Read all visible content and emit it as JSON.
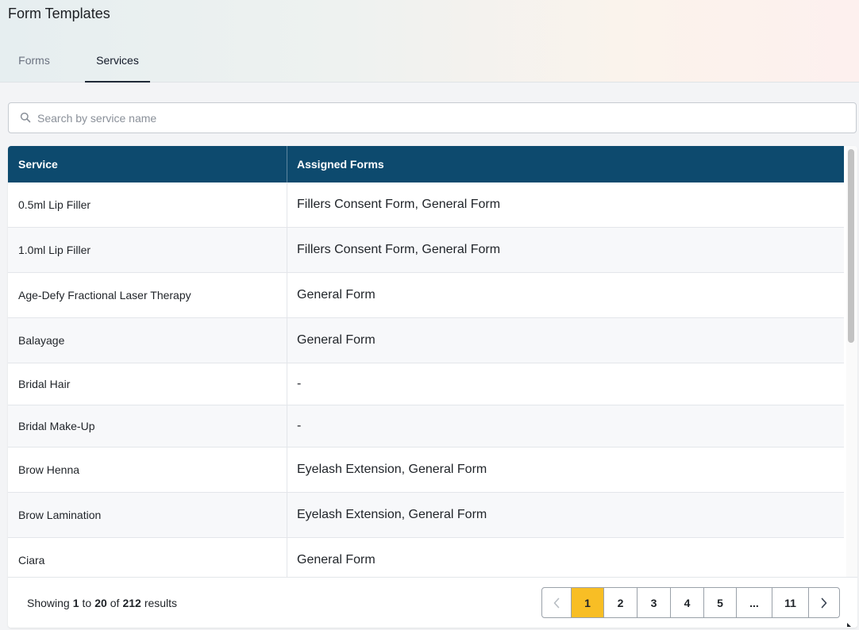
{
  "page": {
    "title": "Form Templates"
  },
  "tabs": [
    {
      "label": "Forms",
      "active": false
    },
    {
      "label": "Services",
      "active": true
    }
  ],
  "search": {
    "placeholder": "Search by service name",
    "value": ""
  },
  "table": {
    "columns": [
      "Service",
      "Assigned Forms"
    ],
    "rows": [
      {
        "service": "0.5ml Lip Filler",
        "forms": "Fillers Consent Form, General Form"
      },
      {
        "service": "1.0ml Lip Filler",
        "forms": "Fillers Consent Form, General Form"
      },
      {
        "service": "Age-Defy Fractional Laser Therapy",
        "forms": "General Form"
      },
      {
        "service": "Balayage",
        "forms": "General Form"
      },
      {
        "service": "Bridal Hair",
        "forms": "-"
      },
      {
        "service": "Bridal Make-Up",
        "forms": "-"
      },
      {
        "service": "Brow Henna",
        "forms": "Eyelash Extension, General Form"
      },
      {
        "service": "Brow Lamination",
        "forms": "Eyelash Extension, General Form"
      },
      {
        "service": "Ciara",
        "forms": "General Form"
      }
    ]
  },
  "footer": {
    "showing_label": "Showing",
    "from": "1",
    "to_label": "to",
    "to": "20",
    "of_label": "of",
    "total": "212",
    "results_label": "results"
  },
  "pagination": {
    "pages": [
      "1",
      "2",
      "3",
      "4",
      "5",
      "...",
      "11"
    ],
    "current": "1"
  },
  "colors": {
    "header_bg": "#0d4a6e",
    "active_page": "#f8be25"
  },
  "icons": {
    "search": "search-icon",
    "prev": "chevron-left-icon",
    "next": "chevron-right-icon"
  }
}
